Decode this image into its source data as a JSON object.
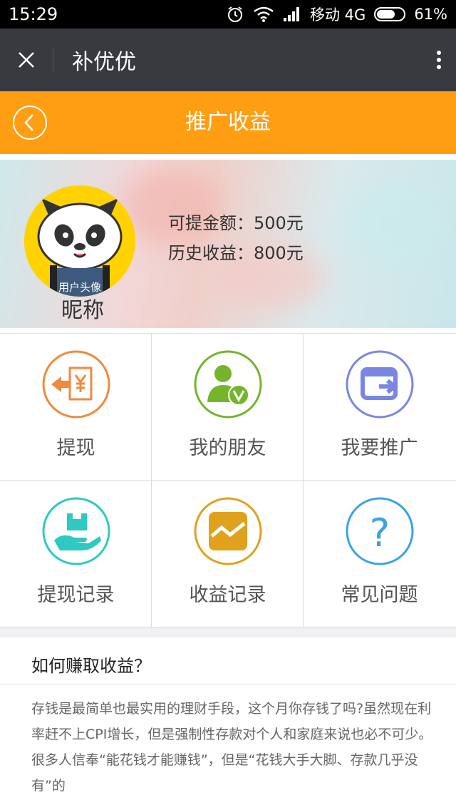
{
  "status_bar": {
    "time": "15:29",
    "carrier": "移动 4G",
    "battery": "61%",
    "icons": [
      "alarm-icon",
      "wifi-icon",
      "signal-icon",
      "battery-icon"
    ]
  },
  "app_bar": {
    "title": "补优优",
    "close_icon": "close-icon",
    "more_icon": "more-vertical-icon"
  },
  "page_header": {
    "title": "推广收益",
    "back_icon": "back-icon",
    "color": "#ff9e12"
  },
  "profile": {
    "avatar_caption": "用户头像",
    "nickname": "昵称",
    "withdrawable": "可提金额：500元",
    "history": "历史收益：800元"
  },
  "menu": [
    {
      "label": "提现",
      "icon": "withdraw-icon",
      "color": "#f08a3c"
    },
    {
      "label": "我的朋友",
      "icon": "friend-icon",
      "color": "#74b52c"
    },
    {
      "label": "我要推广",
      "icon": "promote-icon",
      "color": "#7b86e3"
    },
    {
      "label": "提现记录",
      "icon": "withdraw-record-icon",
      "color": "#2ec9c1"
    },
    {
      "label": "收益记录",
      "icon": "earnings-chart-icon",
      "color": "#e0a21c"
    },
    {
      "label": "常见问题",
      "icon": "question-icon",
      "color": "#3aa3e3"
    }
  ],
  "faq": {
    "question": "如何赚取收益？",
    "answer": "存钱是最简单也最实用的理财手段，这个月你存钱了吗?虽然现在利率赶不上CPI增长，但是强制性存款对个人和家庭来说也必不可少。很多人信奉“能花钱才能赚钱”，但是“花钱大手大脚、存款几乎没有”的"
  }
}
